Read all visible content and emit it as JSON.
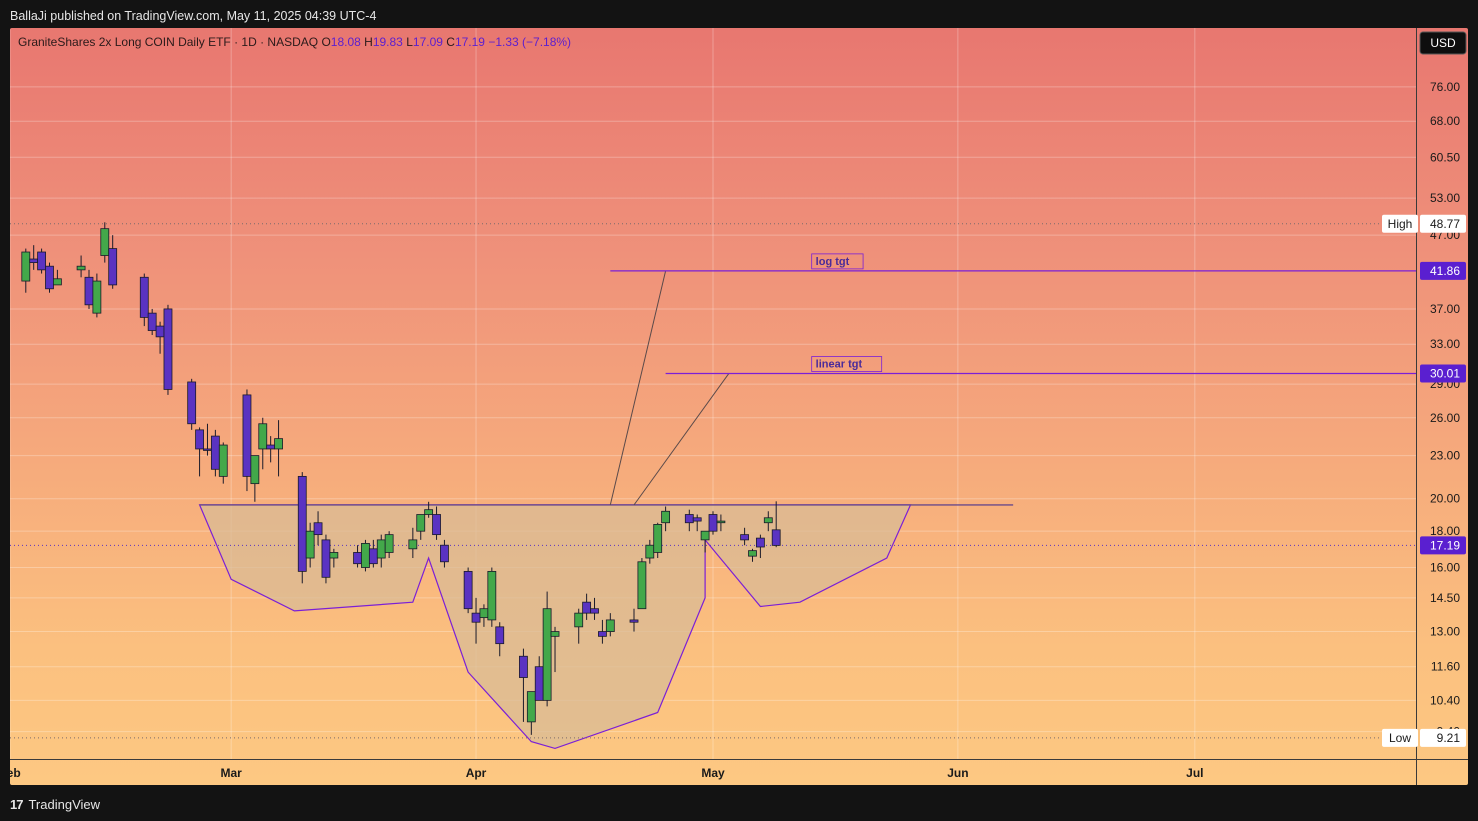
{
  "header": {
    "published": "BallaJi published on TradingView.com, May 11, 2025 04:39 UTC-4"
  },
  "footer": {
    "logo_icon": "tradingview-logo-icon",
    "brand": "TradingView"
  },
  "colors": {
    "up": "#43a84a",
    "down": "#5a33c2",
    "line": "#7b1fd6",
    "pattern_fill": "#d9bb96"
  },
  "chart_data": {
    "type": "candlestick",
    "legend": {
      "symbol": "GraniteShares 2x Long COIN Daily ETF · 1D · NASDAQ",
      "o_label": "O",
      "o": "18.08",
      "h_label": "H",
      "h": "19.83",
      "l_label": "L",
      "l": "17.09",
      "c_label": "C",
      "c": "17.19",
      "change": "−1.33 (−7.18%)"
    },
    "currency": "USD",
    "y_scale": "log",
    "ylim": [
      8.6,
      92
    ],
    "y_ticks": [
      "76.00",
      "68.00",
      "60.50",
      "53.00",
      "47.00",
      "37.00",
      "33.00",
      "29.00",
      "26.00",
      "23.00",
      "20.00",
      "18.00",
      "16.00",
      "14.50",
      "13.00",
      "11.60",
      "10.40",
      "9.40"
    ],
    "x_labels": [
      {
        "date": "2025-02-01",
        "label": "Feb"
      },
      {
        "date": "2025-03-01",
        "label": "Mar"
      },
      {
        "date": "2025-04-01",
        "label": "Apr"
      },
      {
        "date": "2025-05-01",
        "label": "May"
      },
      {
        "date": "2025-06-01",
        "label": "Jun"
      },
      {
        "date": "2025-07-01",
        "label": "Jul"
      }
    ],
    "xlim": [
      "2025-02-01",
      "2025-07-29"
    ],
    "grid": true,
    "candles": [
      {
        "date": "2025-02-03",
        "o": 40.5,
        "h": 45.0,
        "l": 39.0,
        "c": 44.5
      },
      {
        "date": "2025-02-04",
        "o": 43.5,
        "h": 45.5,
        "l": 42.0,
        "c": 43.0
      },
      {
        "date": "2025-02-05",
        "o": 44.5,
        "h": 45.0,
        "l": 41.5,
        "c": 42.0
      },
      {
        "date": "2025-02-06",
        "o": 42.5,
        "h": 43.0,
        "l": 39.0,
        "c": 39.5
      },
      {
        "date": "2025-02-07",
        "o": 40.0,
        "h": 42.0,
        "l": 40.0,
        "c": 40.8
      },
      {
        "date": "2025-02-10",
        "o": 42.0,
        "h": 44.0,
        "l": 41.0,
        "c": 42.5
      },
      {
        "date": "2025-02-11",
        "o": 41.0,
        "h": 42.0,
        "l": 37.0,
        "c": 37.5
      },
      {
        "date": "2025-02-12",
        "o": 36.5,
        "h": 41.5,
        "l": 36.0,
        "c": 40.5
      },
      {
        "date": "2025-02-13",
        "o": 44.0,
        "h": 49.0,
        "l": 43.0,
        "c": 48.0
      },
      {
        "date": "2025-02-14",
        "o": 45.0,
        "h": 47.0,
        "l": 39.5,
        "c": 40.0
      },
      {
        "date": "2025-02-18",
        "o": 41.0,
        "h": 41.5,
        "l": 35.0,
        "c": 36.0
      },
      {
        "date": "2025-02-19",
        "o": 36.5,
        "h": 37.0,
        "l": 34.0,
        "c": 34.5
      },
      {
        "date": "2025-02-20",
        "o": 35.0,
        "h": 35.5,
        "l": 32.0,
        "c": 33.8
      },
      {
        "date": "2025-02-21",
        "o": 37.0,
        "h": 37.5,
        "l": 28.0,
        "c": 28.5
      },
      {
        "date": "2025-02-24",
        "o": 29.2,
        "h": 29.5,
        "l": 25.0,
        "c": 25.5
      },
      {
        "date": "2025-02-25",
        "o": 25.0,
        "h": 25.2,
        "l": 21.5,
        "c": 23.5
      },
      {
        "date": "2025-02-26",
        "o": 23.5,
        "h": 25.5,
        "l": 23.0,
        "c": 23.4
      },
      {
        "date": "2025-02-27",
        "o": 24.5,
        "h": 25.0,
        "l": 21.5,
        "c": 22.0
      },
      {
        "date": "2025-02-28",
        "o": 21.5,
        "h": 24.0,
        "l": 21.0,
        "c": 23.8
      },
      {
        "date": "2025-03-03",
        "o": 28.0,
        "h": 28.5,
        "l": 20.5,
        "c": 21.5
      },
      {
        "date": "2025-03-04",
        "o": 21.0,
        "h": 23.0,
        "l": 19.8,
        "c": 23.0
      },
      {
        "date": "2025-03-05",
        "o": 23.5,
        "h": 26.0,
        "l": 22.0,
        "c": 25.5
      },
      {
        "date": "2025-03-06",
        "o": 23.8,
        "h": 24.5,
        "l": 22.5,
        "c": 23.5
      },
      {
        "date": "2025-03-07",
        "o": 23.5,
        "h": 25.8,
        "l": 21.5,
        "c": 24.3
      },
      {
        "date": "2025-03-10",
        "o": 21.5,
        "h": 21.8,
        "l": 15.2,
        "c": 15.8
      },
      {
        "date": "2025-03-11",
        "o": 16.5,
        "h": 18.5,
        "l": 16.0,
        "c": 18.0
      },
      {
        "date": "2025-03-12",
        "o": 18.5,
        "h": 19.2,
        "l": 17.2,
        "c": 17.8
      },
      {
        "date": "2025-03-13",
        "o": 17.5,
        "h": 17.8,
        "l": 15.2,
        "c": 15.5
      },
      {
        "date": "2025-03-14",
        "o": 16.5,
        "h": 17.0,
        "l": 16.0,
        "c": 16.8
      },
      {
        "date": "2025-03-17",
        "o": 16.8,
        "h": 17.2,
        "l": 16.0,
        "c": 16.2
      },
      {
        "date": "2025-03-18",
        "o": 16.0,
        "h": 17.5,
        "l": 15.8,
        "c": 17.3
      },
      {
        "date": "2025-03-19",
        "o": 17.0,
        "h": 17.5,
        "l": 16.0,
        "c": 16.2
      },
      {
        "date": "2025-03-20",
        "o": 16.5,
        "h": 17.8,
        "l": 16.0,
        "c": 17.5
      },
      {
        "date": "2025-03-21",
        "o": 16.8,
        "h": 18.0,
        "l": 16.5,
        "c": 17.8
      },
      {
        "date": "2025-03-24",
        "o": 17.0,
        "h": 18.2,
        "l": 16.5,
        "c": 17.5
      },
      {
        "date": "2025-03-25",
        "o": 18.0,
        "h": 19.0,
        "l": 17.5,
        "c": 19.0
      },
      {
        "date": "2025-03-26",
        "o": 19.0,
        "h": 19.8,
        "l": 18.8,
        "c": 19.3
      },
      {
        "date": "2025-03-27",
        "o": 19.0,
        "h": 19.5,
        "l": 17.5,
        "c": 17.8
      },
      {
        "date": "2025-03-28",
        "o": 17.2,
        "h": 17.5,
        "l": 16.0,
        "c": 16.3
      },
      {
        "date": "2025-03-31",
        "o": 15.8,
        "h": 16.0,
        "l": 13.8,
        "c": 14.0
      },
      {
        "date": "2025-04-01",
        "o": 13.8,
        "h": 14.5,
        "l": 12.5,
        "c": 13.4
      },
      {
        "date": "2025-04-02",
        "o": 13.6,
        "h": 14.2,
        "l": 13.2,
        "c": 14.0
      },
      {
        "date": "2025-04-03",
        "o": 13.5,
        "h": 16.0,
        "l": 13.2,
        "c": 15.8
      },
      {
        "date": "2025-04-04",
        "o": 13.2,
        "h": 13.4,
        "l": 12.0,
        "c": 12.5
      },
      {
        "date": "2025-04-07",
        "o": 12.0,
        "h": 12.3,
        "l": 9.7,
        "c": 11.2
      },
      {
        "date": "2025-04-08",
        "o": 9.7,
        "h": 10.7,
        "l": 9.3,
        "c": 10.7
      },
      {
        "date": "2025-04-09",
        "o": 11.6,
        "h": 12.0,
        "l": 10.4,
        "c": 10.4
      },
      {
        "date": "2025-04-10",
        "o": 10.4,
        "h": 14.8,
        "l": 10.2,
        "c": 14.0
      },
      {
        "date": "2025-04-11",
        "o": 12.8,
        "h": 13.2,
        "l": 11.4,
        "c": 13.0
      },
      {
        "date": "2025-04-14",
        "o": 13.2,
        "h": 14.0,
        "l": 12.5,
        "c": 13.8
      },
      {
        "date": "2025-04-15",
        "o": 14.3,
        "h": 14.7,
        "l": 13.5,
        "c": 13.8
      },
      {
        "date": "2025-04-16",
        "o": 14.0,
        "h": 14.5,
        "l": 13.5,
        "c": 13.8
      },
      {
        "date": "2025-04-17",
        "o": 13.0,
        "h": 13.5,
        "l": 12.5,
        "c": 12.8
      },
      {
        "date": "2025-04-18",
        "o": 13.0,
        "h": 13.8,
        "l": 12.8,
        "c": 13.5
      },
      {
        "date": "2025-04-21",
        "o": 13.5,
        "h": 14.0,
        "l": 13.0,
        "c": 13.4
      },
      {
        "date": "2025-04-22",
        "o": 14.0,
        "h": 16.5,
        "l": 14.0,
        "c": 16.3
      },
      {
        "date": "2025-04-23",
        "o": 16.5,
        "h": 17.5,
        "l": 16.2,
        "c": 17.2
      },
      {
        "date": "2025-04-24",
        "o": 16.8,
        "h": 18.5,
        "l": 16.5,
        "c": 18.4
      },
      {
        "date": "2025-04-25",
        "o": 18.5,
        "h": 19.5,
        "l": 18.0,
        "c": 19.2
      },
      {
        "date": "2025-04-28",
        "o": 19.0,
        "h": 19.3,
        "l": 18.0,
        "c": 18.5
      },
      {
        "date": "2025-04-29",
        "o": 18.8,
        "h": 19.0,
        "l": 18.0,
        "c": 18.6
      },
      {
        "date": "2025-04-30",
        "o": 17.5,
        "h": 18.0,
        "l": 16.8,
        "c": 18.0
      },
      {
        "date": "2025-05-01",
        "o": 19.0,
        "h": 19.2,
        "l": 17.8,
        "c": 18.0
      },
      {
        "date": "2025-05-02",
        "o": 18.5,
        "h": 19.0,
        "l": 18.0,
        "c": 18.6
      },
      {
        "date": "2025-05-05",
        "o": 17.8,
        "h": 18.2,
        "l": 17.2,
        "c": 17.5
      },
      {
        "date": "2025-05-06",
        "o": 16.6,
        "h": 17.0,
        "l": 16.3,
        "c": 16.9
      },
      {
        "date": "2025-05-07",
        "o": 17.6,
        "h": 17.8,
        "l": 16.5,
        "c": 17.1
      },
      {
        "date": "2025-05-08",
        "o": 18.5,
        "h": 19.2,
        "l": 18.0,
        "c": 18.8
      },
      {
        "date": "2025-05-09",
        "o": 18.08,
        "h": 19.83,
        "l": 17.09,
        "c": 17.19
      }
    ],
    "horizontal_levels": [
      {
        "name": "log tgt",
        "value": 41.86,
        "from": "2025-04-18",
        "label": "log tgt",
        "label_at": "2025-05-14"
      },
      {
        "name": "linear tgt",
        "value": 30.01,
        "from": "2025-04-25",
        "label": "linear tgt",
        "label_at": "2025-05-14"
      }
    ],
    "neckline": {
      "value": 19.6,
      "from": "2025-02-25",
      "to": "2025-06-08"
    },
    "target_projections": [
      {
        "from_date": "2025-04-18",
        "from_value": 19.6,
        "to_date": "2025-04-25",
        "to_value": 41.86
      },
      {
        "from_date": "2025-04-21",
        "from_value": 19.6,
        "to_date": "2025-05-03",
        "to_value": 30.01
      }
    ],
    "pattern_polygon": [
      {
        "date": "2025-02-25",
        "value": 19.6
      },
      {
        "date": "2025-03-01",
        "value": 15.4
      },
      {
        "date": "2025-03-09",
        "value": 13.9
      },
      {
        "date": "2025-03-24",
        "value": 14.3
      },
      {
        "date": "2025-03-26",
        "value": 16.5
      },
      {
        "date": "2025-03-31",
        "value": 11.4
      },
      {
        "date": "2025-04-08",
        "value": 9.1
      },
      {
        "date": "2025-04-11",
        "value": 8.9
      },
      {
        "date": "2025-04-24",
        "value": 10.0
      },
      {
        "date": "2025-04-30",
        "value": 14.5
      },
      {
        "date": "2025-04-30",
        "value": 17.5
      },
      {
        "date": "2025-05-07",
        "value": 14.1
      },
      {
        "date": "2025-05-12",
        "value": 14.3
      },
      {
        "date": "2025-05-23",
        "value": 16.5
      },
      {
        "date": "2025-05-26",
        "value": 19.6
      }
    ],
    "price_markers": [
      {
        "name": "high",
        "label": "High",
        "value_text": "48.77",
        "value": 48.77
      },
      {
        "name": "log-target",
        "label": "",
        "value_text": "41.86",
        "value": 41.86
      },
      {
        "name": "linear-target",
        "label": "",
        "value_text": "30.01",
        "value": 30.01
      },
      {
        "name": "last-price",
        "label": "",
        "value_text": "17.19",
        "value": 17.19
      },
      {
        "name": "low",
        "label": "Low",
        "value_text": "9.21",
        "value": 9.21
      }
    ]
  }
}
